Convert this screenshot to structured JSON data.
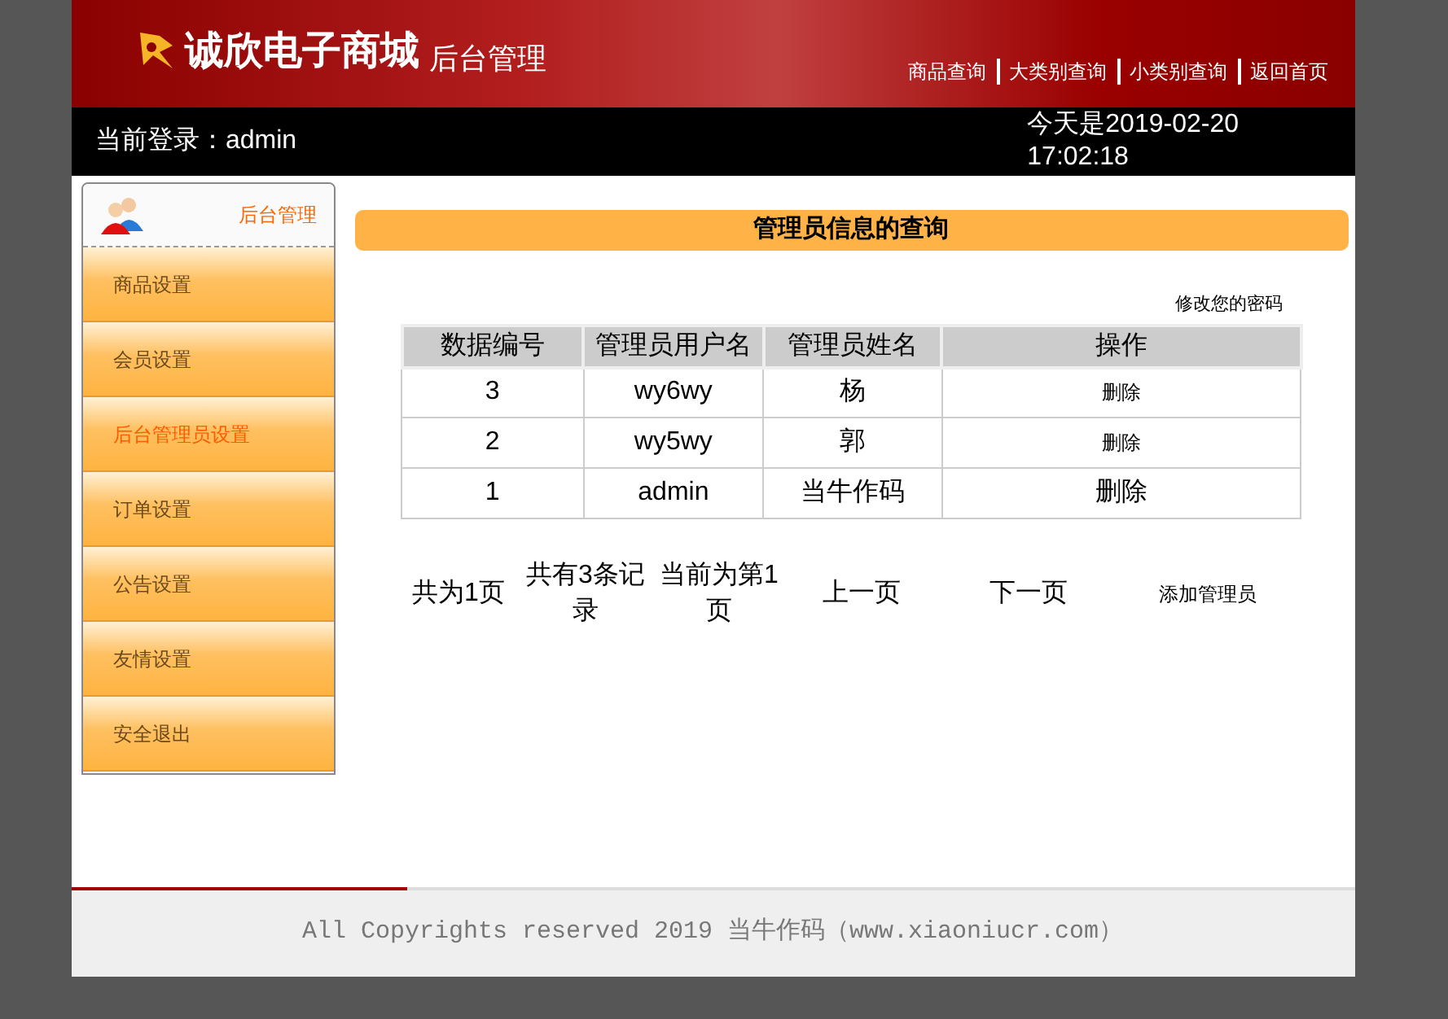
{
  "header": {
    "brand": "诚欣电子商城",
    "subtitle": "后台管理",
    "nav": [
      "商品查询",
      "大类别查询",
      "小类别查询",
      "返回首页"
    ]
  },
  "login_bar": {
    "user": "当前登录：admin",
    "date": "今天是2019-02-20",
    "time": "17:02:18"
  },
  "sidebar": {
    "title": "后台管理",
    "items": [
      {
        "label": "商品设置",
        "selected": false
      },
      {
        "label": "会员设置",
        "selected": false
      },
      {
        "label": "后台管理员设置",
        "selected": true
      },
      {
        "label": "订单设置",
        "selected": false
      },
      {
        "label": "公告设置",
        "selected": false
      },
      {
        "label": "友情设置",
        "selected": false
      },
      {
        "label": "安全退出",
        "selected": false
      }
    ]
  },
  "content": {
    "title": "管理员信息的查询",
    "change_password": "修改您的密码",
    "table": {
      "columns": [
        "数据编号",
        "管理员用户名",
        "管理员姓名",
        "操作"
      ],
      "rows": [
        {
          "cells": [
            "3",
            "wy6wy",
            "杨"
          ],
          "action": {
            "label": "删除",
            "kind": "small"
          }
        },
        {
          "cells": [
            "2",
            "wy5wy",
            "郭"
          ],
          "action": {
            "label": "删除",
            "kind": "small"
          }
        },
        {
          "cells": [
            "1",
            "admin",
            "当牛作码"
          ],
          "action": {
            "label": "删除",
            "kind": "large"
          }
        }
      ]
    },
    "pagination": {
      "total_pages": "共为1页",
      "total_records": "共有3条记录",
      "current_page": "当前为第1页",
      "prev": "上一页",
      "next": "下一页",
      "add": "添加管理员"
    }
  },
  "footer": "All Copyrights reserved 2019 当牛作码（www.xiaoniucr.com）"
}
